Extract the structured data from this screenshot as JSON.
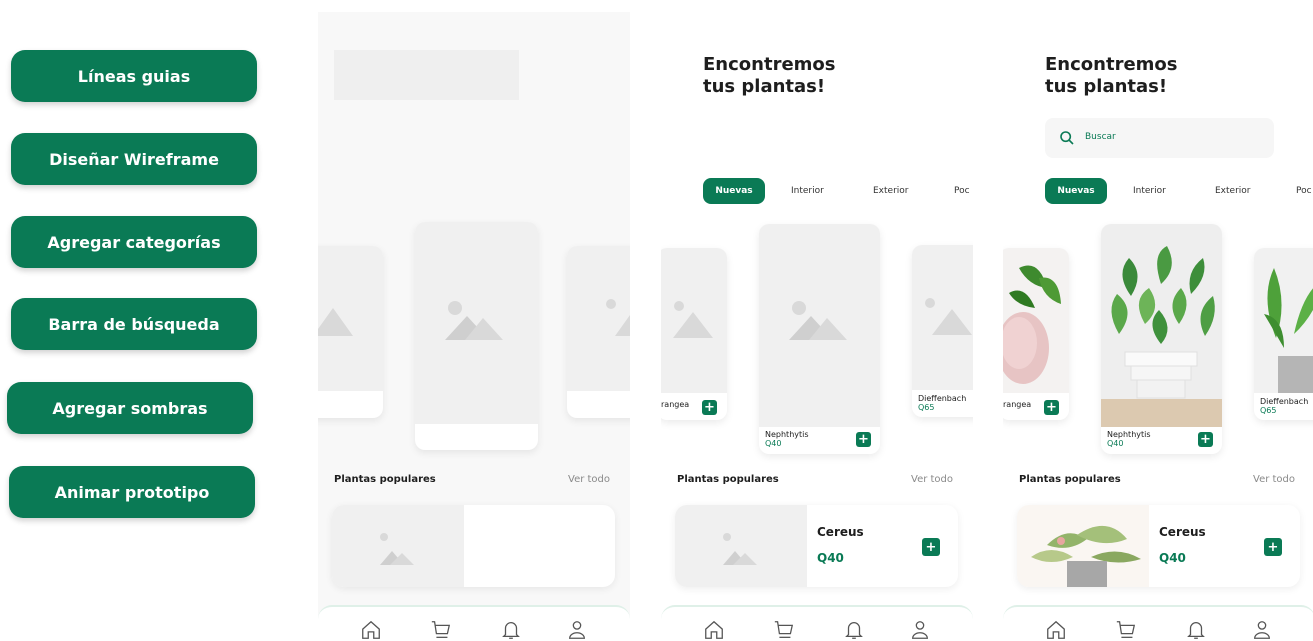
{
  "steps": [
    {
      "label": "Líneas guias"
    },
    {
      "label": "Diseñar Wireframe"
    },
    {
      "label": "Agregar categorías"
    },
    {
      "label": "Barra de búsqueda"
    },
    {
      "label": "Agregar sombras"
    },
    {
      "label": "Animar prototipo"
    }
  ],
  "app": {
    "title_line1": "Encontremos",
    "title_line2": "tus plantas!",
    "search_placeholder": "Buscar",
    "tabs": [
      "Nuevas",
      "Interior",
      "Exterior",
      "Poc"
    ],
    "plants": [
      {
        "name": "rangea",
        "price": ""
      },
      {
        "name": "Nephthytis",
        "price": "Q40"
      },
      {
        "name": "Dieffenbach",
        "price": "Q65"
      }
    ],
    "popular_title": "Plantas populares",
    "see_all": "Ver todo",
    "popular_item": {
      "name": "Cereus",
      "price": "Q40"
    },
    "nav_icons": [
      "home-icon",
      "cart-icon",
      "bell-icon",
      "user-icon"
    ],
    "accent": "#0a7a55"
  }
}
